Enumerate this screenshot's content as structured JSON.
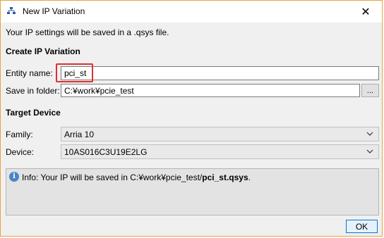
{
  "window": {
    "title": "New IP Variation",
    "title_icon": "ip-variation-icon",
    "close_label": "✕"
  },
  "description": "Your IP settings will be saved in a .qsys file.",
  "create_section": {
    "heading": "Create IP Variation",
    "entity_label": "Entity name:",
    "entity_value": "pci_st",
    "folder_label": "Save in folder:",
    "folder_value": "C:¥work¥pcie_test",
    "browse_label": "..."
  },
  "target_section": {
    "heading": "Target Device",
    "family_label": "Family:",
    "family_value": "Arria 10",
    "device_label": "Device:",
    "device_value": "10AS016C3U19E2LG"
  },
  "info": {
    "prefix": "Info: Your IP will be saved in C:¥work¥pcie_test/",
    "filename": "pci_st.qsys",
    "suffix": "."
  },
  "ok_label": "OK",
  "colors": {
    "highlight": "#e03030",
    "accent": "#0078d7",
    "window_border": "#e8a33a"
  }
}
